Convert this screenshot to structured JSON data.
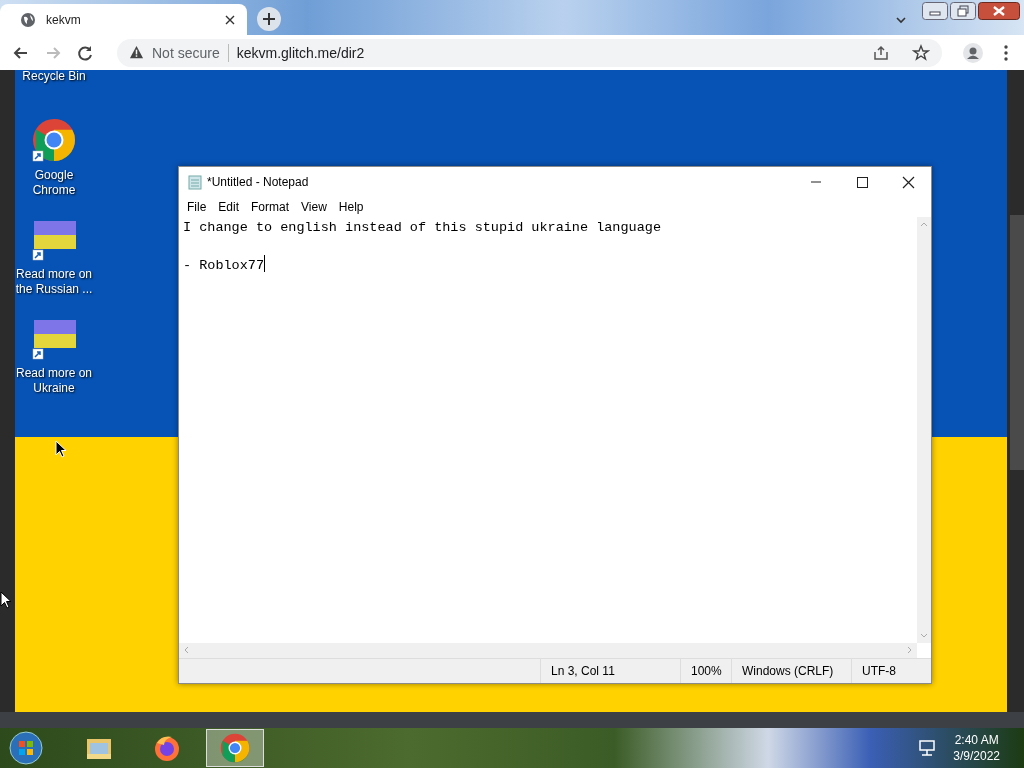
{
  "browser": {
    "tab": {
      "title": "kekvm",
      "selected": true
    },
    "address": {
      "security": "Not secure",
      "url": "kekvm.glitch.me/dir2"
    }
  },
  "desktop": {
    "icons": [
      {
        "label": "Recycle Bin",
        "kind": "recycle"
      },
      {
        "label": "Google Chrome",
        "kind": "chrome"
      },
      {
        "label": "Read more on the Russian ...",
        "kind": "flag"
      },
      {
        "label": "Read more on Ukraine",
        "kind": "flag"
      }
    ]
  },
  "notepad": {
    "title": "*Untitled - Notepad",
    "menu": [
      "File",
      "Edit",
      "Format",
      "View",
      "Help"
    ],
    "text": "I change to english instead of this stupid ukraine language\n\n- Roblox77",
    "status": [
      "Ln 3, Col 11",
      "100%",
      "Windows (CRLF)",
      "UTF-8"
    ]
  },
  "taskbar": {
    "apps": [
      {
        "kind": "explorer",
        "selected": false
      },
      {
        "kind": "firefox",
        "selected": false
      },
      {
        "kind": "chrome",
        "selected": true
      }
    ],
    "time": "2:40 AM",
    "date": "3/9/2022"
  }
}
